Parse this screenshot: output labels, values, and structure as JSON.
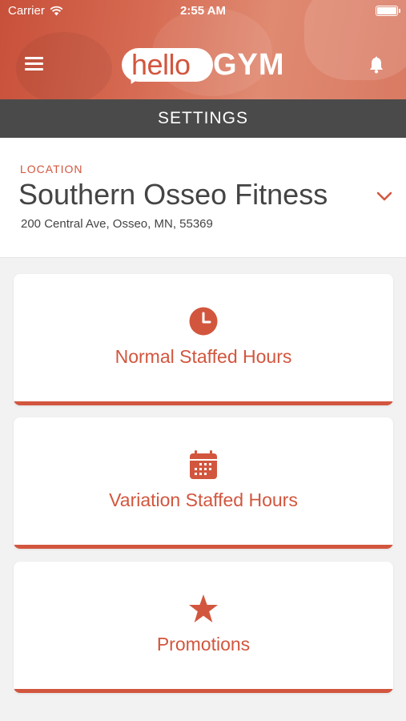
{
  "status_bar": {
    "carrier": "Carrier",
    "time": "2:55 AM"
  },
  "header": {
    "logo_hello": "hello",
    "logo_gym": "GYM",
    "menu_icon": "hamburger-menu-icon",
    "bell_icon": "bell-icon",
    "accent_color": "#d2563e"
  },
  "page_title": "SETTINGS",
  "location": {
    "label": "LOCATION",
    "name": "Southern Osseo Fitness",
    "address": "200 Central Ave, Osseo, MN, 55369",
    "dropdown_icon": "chevron-down-icon"
  },
  "cards": [
    {
      "label": "Normal Staffed Hours",
      "icon": "clock-icon"
    },
    {
      "label": "Variation Staffed Hours",
      "icon": "calendar-icon"
    },
    {
      "label": "Promotions",
      "icon": "star-icon"
    }
  ]
}
